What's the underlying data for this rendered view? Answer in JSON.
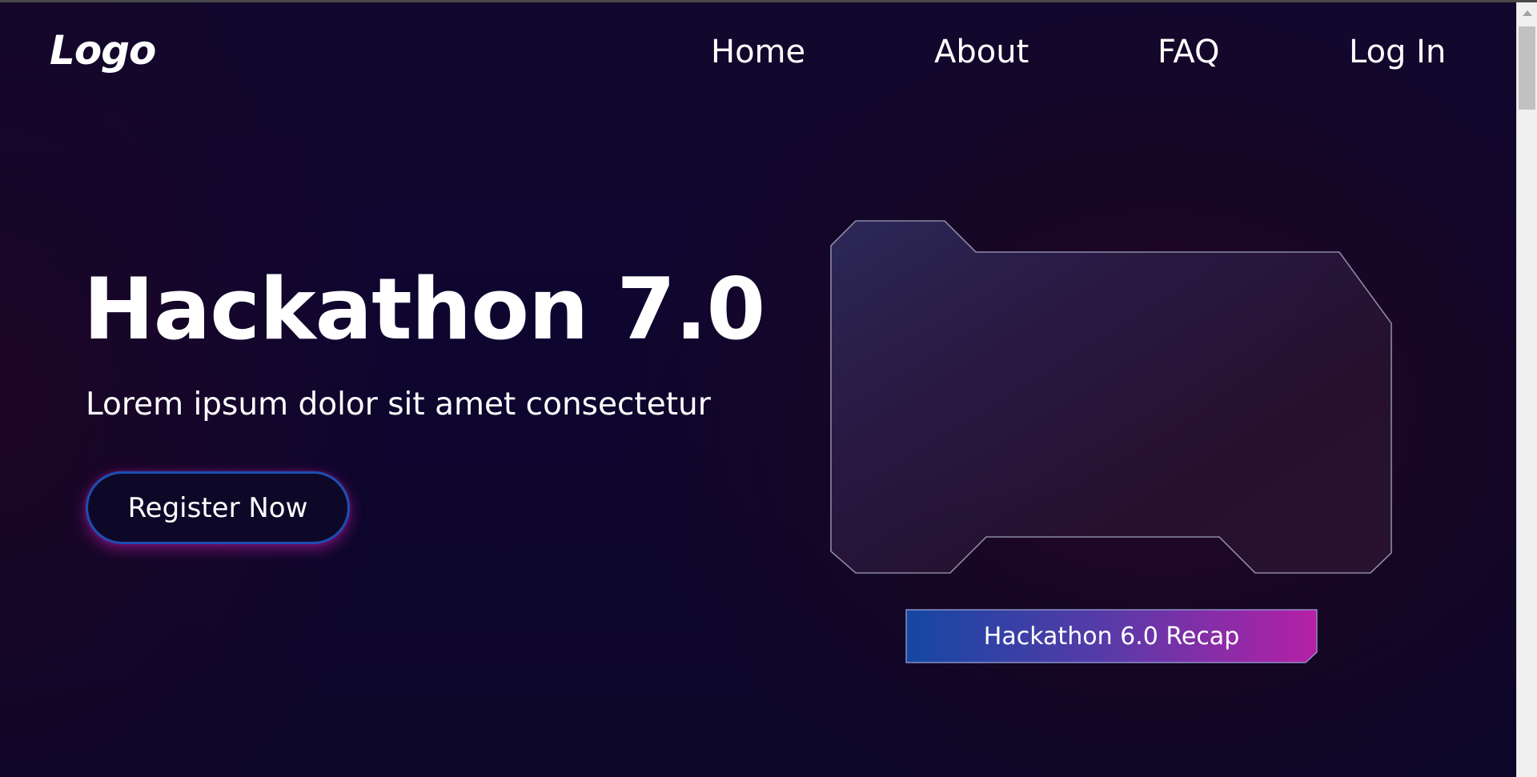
{
  "header": {
    "logo": "Logo",
    "nav": [
      {
        "label": "Home"
      },
      {
        "label": "About"
      },
      {
        "label": "FAQ"
      },
      {
        "label": "Log In"
      }
    ]
  },
  "hero": {
    "title": "Hackathon 7.0",
    "subtitle": "Lorem ipsum dolor sit amet consectetur",
    "register_label": "Register Now"
  },
  "recap": {
    "label": "Hackathon 6.0 Recap"
  },
  "colors": {
    "background": "#0d0626",
    "button_border": "#1c4fb3",
    "button_glow": "#be1eaa",
    "recap_gradient_start": "#1547a3",
    "recap_gradient_end": "#b520a6",
    "frame_outline": "#8c8aa3"
  }
}
